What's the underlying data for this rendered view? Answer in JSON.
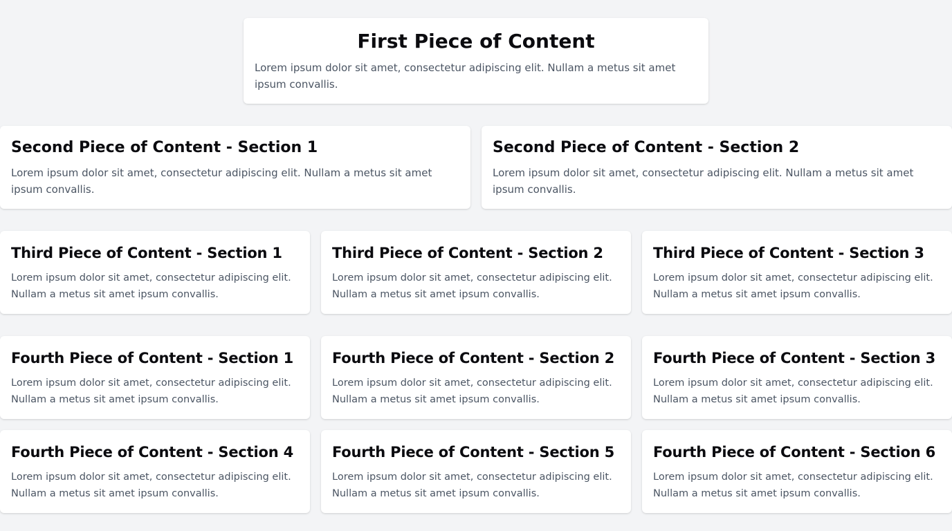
{
  "first": {
    "title": "First Piece of Content",
    "body": "Lorem ipsum dolor sit amet, consectetur adipiscing elit. Nullam a metus sit amet ipsum convallis."
  },
  "second": [
    {
      "title": "Second Piece of Content - Section 1",
      "body": "Lorem ipsum dolor sit amet, consectetur adipiscing elit. Nullam a metus sit amet ipsum convallis."
    },
    {
      "title": "Second Piece of Content - Section 2",
      "body": "Lorem ipsum dolor sit amet, consectetur adipiscing elit. Nullam a metus sit amet ipsum convallis."
    }
  ],
  "third": [
    {
      "title": "Third Piece of Content - Section 1",
      "body": "Lorem ipsum dolor sit amet, consectetur adipiscing elit. Nullam a metus sit amet ipsum convallis."
    },
    {
      "title": "Third Piece of Content - Section 2",
      "body": "Lorem ipsum dolor sit amet, consectetur adipiscing elit. Nullam a metus sit amet ipsum convallis."
    },
    {
      "title": "Third Piece of Content - Section 3",
      "body": "Lorem ipsum dolor sit amet, consectetur adipiscing elit. Nullam a metus sit amet ipsum convallis."
    }
  ],
  "fourth": [
    {
      "title": "Fourth Piece of Content - Section 1",
      "body": "Lorem ipsum dolor sit amet, consectetur adipiscing elit. Nullam a metus sit amet ipsum convallis."
    },
    {
      "title": "Fourth Piece of Content - Section 2",
      "body": "Lorem ipsum dolor sit amet, consectetur adipiscing elit. Nullam a metus sit amet ipsum convallis."
    },
    {
      "title": "Fourth Piece of Content - Section 3",
      "body": "Lorem ipsum dolor sit amet, consectetur adipiscing elit. Nullam a metus sit amet ipsum convallis."
    },
    {
      "title": "Fourth Piece of Content - Section 4",
      "body": "Lorem ipsum dolor sit amet, consectetur adipiscing elit. Nullam a metus sit amet ipsum convallis."
    },
    {
      "title": "Fourth Piece of Content - Section 5",
      "body": "Lorem ipsum dolor sit amet, consectetur adipiscing elit. Nullam a metus sit amet ipsum convallis."
    },
    {
      "title": "Fourth Piece of Content - Section 6",
      "body": "Lorem ipsum dolor sit amet, consectetur adipiscing elit. Nullam a metus sit amet ipsum convallis."
    }
  ]
}
